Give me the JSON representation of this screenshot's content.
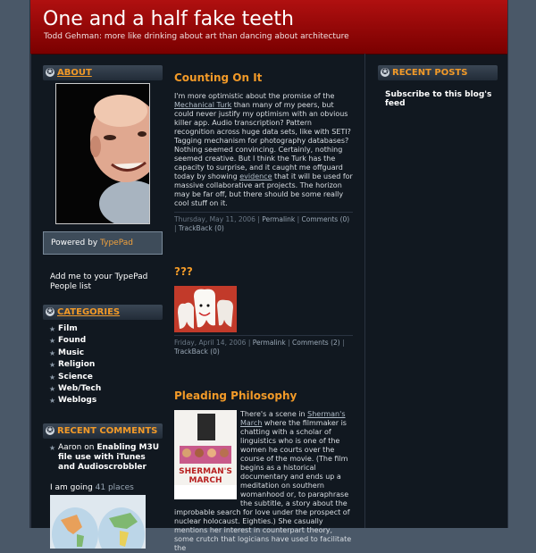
{
  "blog": {
    "title": "One and a half fake teeth",
    "description": "Todd Gehman: more like drinking about art than dancing about architecture"
  },
  "left_sidebar": {
    "about_heading": "ABOUT",
    "powered_by_prefix": "Powered by ",
    "powered_by_link": "TypePad",
    "people_list_text": "Add me to your TypePad People list",
    "categories_heading": "CATEGORIES",
    "categories": [
      "Film",
      "Found",
      "Music",
      "Religion",
      "Science",
      "Web/Tech",
      "Weblogs"
    ],
    "recent_comments_heading": "RECENT COMMENTS",
    "recent_comment": {
      "author": "Aaron",
      "connector": " on ",
      "post": "Enabling M3U file use with iTunes and Audioscrobbler"
    },
    "places_prefix": "I am going ",
    "places_count": "41 places"
  },
  "posts": [
    {
      "title": "Counting On It",
      "body_1": "I'm more optimistic about the promise of the ",
      "link_1": "Mechanical Turk",
      "body_2": " than many of my peers, but could never justify my optimism with an obvious killer app.  Audio transcription?  Pattern recognition across huge data sets, like with SETI?  Tagging mechanism for photography databases?  Nothing seemed convincing.  Certainly, nothing seemed creative.  But I think the Turk has the capacity to surprise, and it caught me offguard today by showing ",
      "link_2": "evidence",
      "body_3": " that it will be used for massive collaborative art projects.  The horizon may be far off, but there should be some really cool stuff on it.",
      "date": "Thursday, May 11, 2006",
      "permalink": "Permalink",
      "comments": "Comments (0)",
      "trackback": "TrackBack (0)"
    },
    {
      "title": "???",
      "date": "Friday, April 14, 2006",
      "permalink": "Permalink",
      "comments": "Comments (2)",
      "trackback": "TrackBack (0)"
    },
    {
      "title": "Pleading Philosophy",
      "body_1": "There's a scene in ",
      "link_1": "Sherman's March",
      "body_2": " where the filmmaker is chatting with a scholar of linguistics who is one of the women he courts over the course of the movie.  (The film begins as a historical documentary and ends up a meditation on southern womanhood or, to paraphrase the subtitle, a story about the improbable search for love under the prospect of nuclear holocaust.  Eighties.)  She casually mentions her interest in counterpart theory, some crutch that logicians have used to facilitate the",
      "poster_title": "SHERMAN'S MARCH"
    }
  ],
  "right_sidebar": {
    "recent_posts_heading": "RECENT POSTS",
    "feed_text": "Subscribe to this blog's feed"
  },
  "colors": {
    "banner": "#9b0a0a",
    "accent": "#f29a28",
    "background": "#111820"
  }
}
